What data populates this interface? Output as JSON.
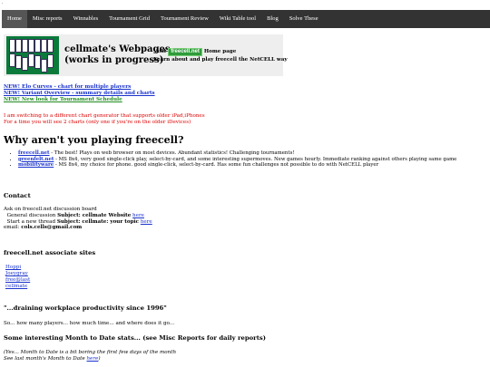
{
  "nav": {
    "items": [
      "Home",
      "Misc reports",
      "Winnables",
      "Tournament Grid",
      "Tournament Review",
      "Wiki Table tool",
      "Blog",
      "Solve These"
    ]
  },
  "banner": {
    "title_line1": "cellmate's Webpages",
    "title_line2": "(works in progress)",
    "visit_prefix": "Visit",
    "logo_text": "freecell.net",
    "visit_suffix": "Home page",
    "subline": "Learn about and play freecell the NetCELL way"
  },
  "news": [
    "NEW! Elo Curves - chart for multiple players",
    "NEW! Variant Overview - summary details and charts",
    "NEW! New look for Tournament Schedule"
  ],
  "notice": {
    "line1": "I am switching to a different chart generator that supports older iPad,iPhones",
    "line2": "For a time you will see 2 charts (only one if you're on the older iDevices)"
  },
  "why": {
    "heading": "Why aren't you playing freecell?",
    "items": [
      {
        "link": "freecell.net",
        "text": " - The best! Plays on web browser on most devices. Abundant statistics! Challenging tournaments!"
      },
      {
        "link": "greenfelt.net",
        "text": " - MS 8x4, very good single-click play, select-by-card, and some interesting supermoves. New games hourly. Immediate ranking against others playing same game"
      },
      {
        "link": "mobilityware",
        "text": " - MS 8x4, my choice for phone. good single-click, select-by-card. Has some fun challenges not possible to do with NetCELL player"
      }
    ]
  },
  "contact": {
    "heading": "Contact",
    "line1": "Ask on freecell.net discussion board",
    "general_prefix": "General discussion ",
    "general_subject": "Subject: cellmate Website",
    "general_link": "here",
    "thread_prefix": "Start a new thread ",
    "thread_subject": "Subject: cellmate: your topic",
    "thread_link": "here",
    "email_label": "email: ",
    "email": "cols.cells@gmail.com"
  },
  "associates": {
    "heading": "freecell.net associate sites",
    "links": [
      "Hoppi",
      "Joeygray",
      "free@last",
      "cellmate"
    ]
  },
  "tagline": "\"...draining workplace productivity since 1996\"",
  "players_line": "So... how many players... how much time... and where does it go...",
  "mtd": {
    "heading": "Some interesting Month to Date stats... (see Misc Reports for daily reports)",
    "line1": "(Yes... Month to Date is a bit boring the first few days of the month",
    "line2_prefix": "See last month's Month to Date ",
    "line2_link": "here",
    "line2_suffix": ")"
  }
}
